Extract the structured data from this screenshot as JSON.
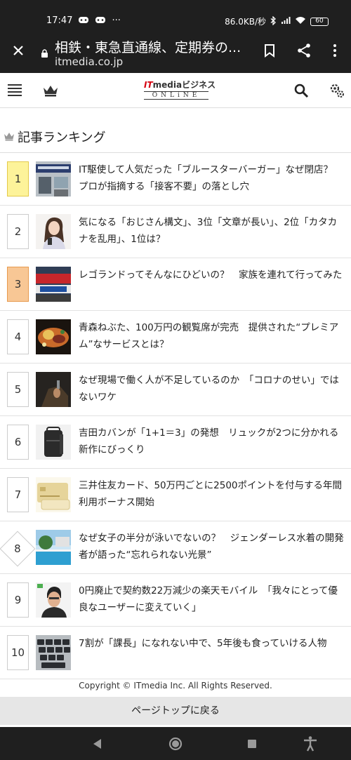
{
  "status_bar": {
    "time": "17:47",
    "more": "···",
    "network_speed": "86.0KB/秒",
    "battery": "60"
  },
  "browser": {
    "page_title": "相鉄・東急直通線、定期券の...",
    "url": "itmedia.co.jp"
  },
  "site_header": {
    "logo_it": "IT",
    "logo_media": "media",
    "logo_biz": "ビジネス",
    "logo_online": "ONLiNE"
  },
  "ranking": {
    "heading": "記事ランキング",
    "items": [
      {
        "rank": "1",
        "title": "IT駆使して人気だった「ブルースターバーガー」なぜ閉店？　プロが指摘する「接客不要」の落とし穴"
      },
      {
        "rank": "2",
        "title": "気になる「おじさん構文」、3位「文章が長い」、2位「カタカナを乱用」、1位は？"
      },
      {
        "rank": "3",
        "title": "レゴランドってそんなにひどいの？　家族を連れて行ってみた"
      },
      {
        "rank": "4",
        "title": "青森ねぶた、100万円の観覧席が完売　提供された“プレミアム”なサービスとは？"
      },
      {
        "rank": "5",
        "title": "なぜ現場で働く人が不足しているのか　「コロナのせい」ではないワケ"
      },
      {
        "rank": "6",
        "title": "吉田カバンが「1+1＝3」の発想　リュックが2つに分かれる新作にびっくり"
      },
      {
        "rank": "7",
        "title": "三井住友カード、50万円ごとに2500ポイントを付与する年間利用ボーナス開始"
      },
      {
        "rank": "8",
        "title": "なぜ女子の半分が泳いでないの？　ジェンダーレス水着の開発者が語った“忘れられない光景”"
      },
      {
        "rank": "9",
        "title": "0円廃止で契約数22万減少の楽天モバイル　「我々にとって優良なユーザーに変えていく」"
      },
      {
        "rank": "10",
        "title": "7割が「課長」になれない中で、5年後も食っていける人物"
      }
    ]
  },
  "footer": {
    "copyright": "Copyright © ITmedia Inc. All Rights Reserved.",
    "back_to_top": "ページトップに戻る"
  },
  "colors": {
    "rank1_bg": "#fdf39a",
    "rank3_bg": "#f8c795",
    "chrome_bg": "#1f1f1f",
    "logo_red": "#d6000f"
  }
}
